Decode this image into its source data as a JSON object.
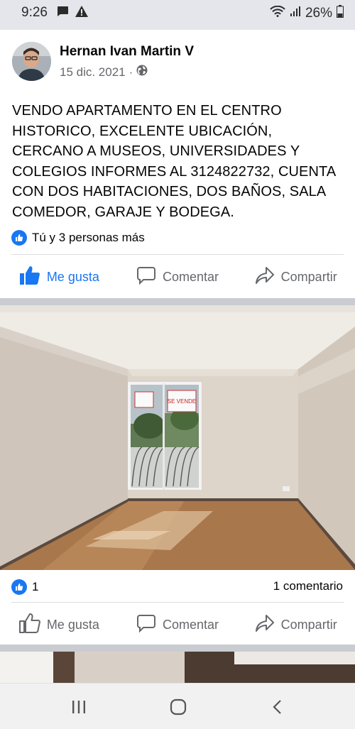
{
  "status_bar": {
    "time": "9:26",
    "battery": "26%",
    "icons": [
      "message-icon",
      "warning-icon",
      "wifi-icon",
      "signal-icon",
      "battery-icon"
    ]
  },
  "post1": {
    "author": "Hernan Ivan Martin V",
    "date": "15 dic. 2021",
    "separator": "·",
    "privacy_icon": "globe-icon",
    "text": "VENDO APARTAMENTO EN EL CENTRO HISTORICO, EXCELENTE UBICACIÓN, CERCANO A  MUSEOS, UNIVERSIDADES Y COLEGIOS INFORMES AL 3124822732, CUENTA CON DOS HABITACIONES, DOS BAÑOS, SALA COMEDOR, GARAJE Y BODEGA.",
    "reactions_text": "Tú y 3 personas más",
    "actions": {
      "like": "Me gusta",
      "comment": "Comentar",
      "share": "Compartir"
    },
    "liked": true
  },
  "post2": {
    "image_alt": "apartment-room-photo",
    "window_sign": "SE VENDE",
    "reactions_count": "1",
    "comments": "1 comentario",
    "actions": {
      "like": "Me gusta",
      "comment": "Comentar",
      "share": "Compartir"
    },
    "liked": false
  },
  "colors": {
    "accent": "#1877f2",
    "secondary_text": "#65676b",
    "separator": "#c9ccd1"
  }
}
